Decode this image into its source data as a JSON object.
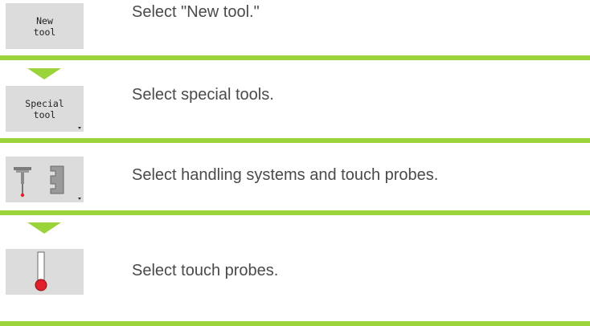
{
  "steps": [
    {
      "softkey": "New\ntool",
      "has_dropdown": false,
      "description": "Select \"New tool.\""
    },
    {
      "softkey": "Special\ntool",
      "has_dropdown": true,
      "description": "Select special tools."
    },
    {
      "softkey_icons": [
        "touch-probe-icon",
        "handling-system-gripper-icon"
      ],
      "has_dropdown": true,
      "description": "Select handling systems and touch probes."
    },
    {
      "softkey_icons": [
        "touch-probe-icon"
      ],
      "has_dropdown": false,
      "description": "Select touch probes."
    }
  ],
  "colors": {
    "accent_bar": "#9bd33a",
    "softkey_bg": "#dcdcdc",
    "probe_tip": "#e0202a",
    "text": "#4a4a4a"
  }
}
